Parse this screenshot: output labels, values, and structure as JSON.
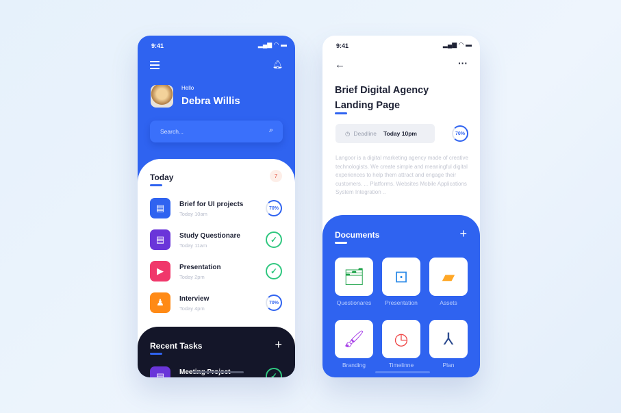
{
  "home": {
    "time": "9:41",
    "greeting": "Hello",
    "user_name": "Debra Willis",
    "search_placeholder": "Search...",
    "today": {
      "title": "Today",
      "count": "7",
      "tasks": [
        {
          "title": "Brief for UI projects",
          "time": "Today 10am",
          "status": "progress",
          "progress": "70%",
          "icon": "document-icon",
          "color": "#2f63f0"
        },
        {
          "title": "Study Questionare",
          "time": "Today 11am",
          "status": "done",
          "icon": "document-icon",
          "color": "#6a35d9"
        },
        {
          "title": "Presentation",
          "time": "Today 2pm",
          "status": "done",
          "icon": "presentation-icon",
          "color": "#f0386b"
        },
        {
          "title": "Interview",
          "time": "Today 4pm",
          "status": "progress",
          "progress": "70%",
          "icon": "people-icon",
          "color": "#ff8a16"
        }
      ]
    },
    "recent": {
      "title": "Recent Tasks",
      "add": "+",
      "tasks": [
        {
          "title": "Meeting Project",
          "status": "done"
        }
      ]
    }
  },
  "detail": {
    "time": "9:41",
    "title_line1": "Brief Digital Agency",
    "title_line2": "Landing Page",
    "deadline_label": "Deadline",
    "deadline_value": "Today 10pm",
    "progress": "70%",
    "description": "Langoor is a digital marketing agency made of creative technologists. We create simple and meaningful digital experiences to help them attract and engage their customers. ... Platforms. Websites Mobile Applications System Integration ..",
    "documents": {
      "title": "Documents",
      "add": "+",
      "items": [
        {
          "label": "Questionares",
          "icon": "folder-document-icon",
          "color": "#1fa34a"
        },
        {
          "label": "Presentation",
          "icon": "presentation-icon",
          "color": "#2f8ce8"
        },
        {
          "label": "Assets",
          "icon": "folder-icon",
          "color": "#ffa726"
        },
        {
          "label": "Branding",
          "icon": "brush-icon",
          "color": "#a63de8"
        },
        {
          "label": "Timelinne",
          "icon": "timeline-icon",
          "color": "#ef4a4a"
        },
        {
          "label": "Plan",
          "icon": "pdf-icon",
          "color": "#2d4b8f"
        }
      ]
    }
  },
  "colors": {
    "primary": "#2f63f0",
    "dark": "#141629",
    "success": "#2fc77f"
  }
}
